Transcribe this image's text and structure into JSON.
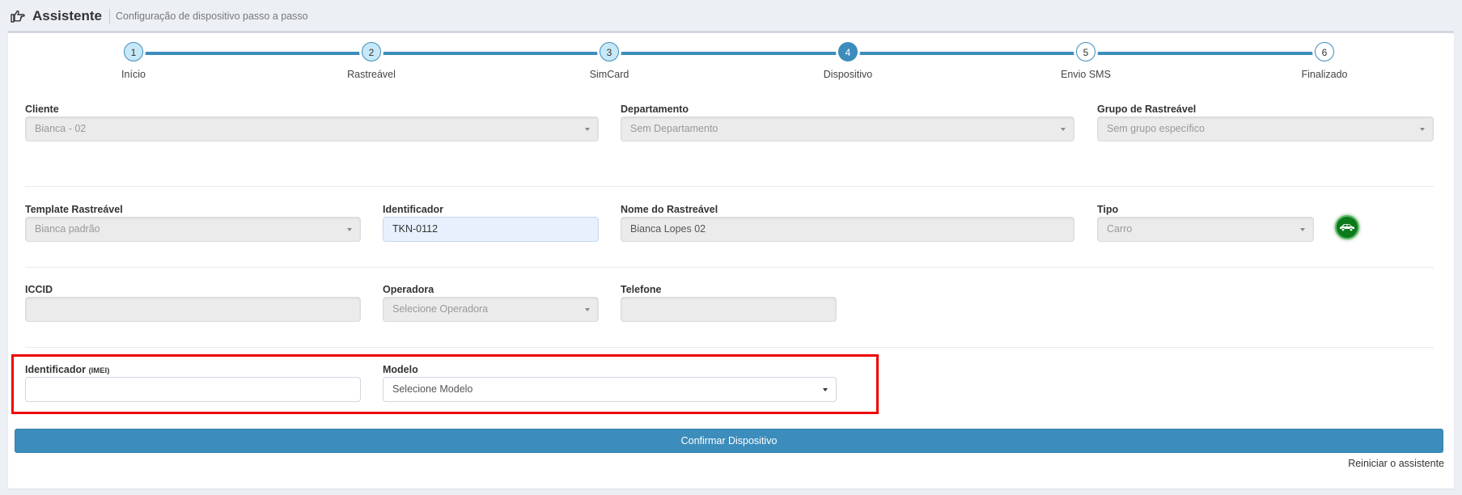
{
  "header": {
    "title": "Assistente",
    "subtitle": "Configuração de dispositivo passo a passo"
  },
  "steps": [
    {
      "number": "1",
      "label": "Início",
      "state": "done"
    },
    {
      "number": "2",
      "label": "Rastreável",
      "state": "done"
    },
    {
      "number": "3",
      "label": "SimCard",
      "state": "done"
    },
    {
      "number": "4",
      "label": "Dispositivo",
      "state": "active"
    },
    {
      "number": "5",
      "label": "Envio SMS",
      "state": "todo"
    },
    {
      "number": "6",
      "label": "Finalizado",
      "state": "todo"
    }
  ],
  "form": {
    "cliente": {
      "label": "Cliente",
      "value": "Bianca - 02"
    },
    "departamento": {
      "label": "Departamento",
      "value": "Sem Departamento"
    },
    "grupo": {
      "label": "Grupo de Rastreável",
      "value": "Sem grupo específico"
    },
    "template": {
      "label": "Template Rastreável",
      "value": "Bianca padrão"
    },
    "identificador": {
      "label": "Identificador",
      "value": "TKN-0112"
    },
    "nome": {
      "label": "Nome do Rastreável",
      "value": "Bianca Lopes 02"
    },
    "tipo": {
      "label": "Tipo",
      "value": "Carro",
      "icon": "car-icon"
    },
    "iccid": {
      "label": "ICCID",
      "value": ""
    },
    "operadora": {
      "label": "Operadora",
      "value": "Selecione Operadora"
    },
    "telefone": {
      "label": "Telefone",
      "value": ""
    },
    "imei": {
      "label": "Identificador",
      "label_suffix": "(IMEI)",
      "value": ""
    },
    "modelo": {
      "label": "Modelo",
      "value": "Selecione Modelo"
    }
  },
  "actions": {
    "confirm_label": "Confirmar Dispositivo",
    "restart_label": "Reiniciar o assistente"
  },
  "colors": {
    "primary": "#3c8dbc",
    "highlight_border": "#e00000",
    "vehicle_icon": "#0b7a1a"
  }
}
